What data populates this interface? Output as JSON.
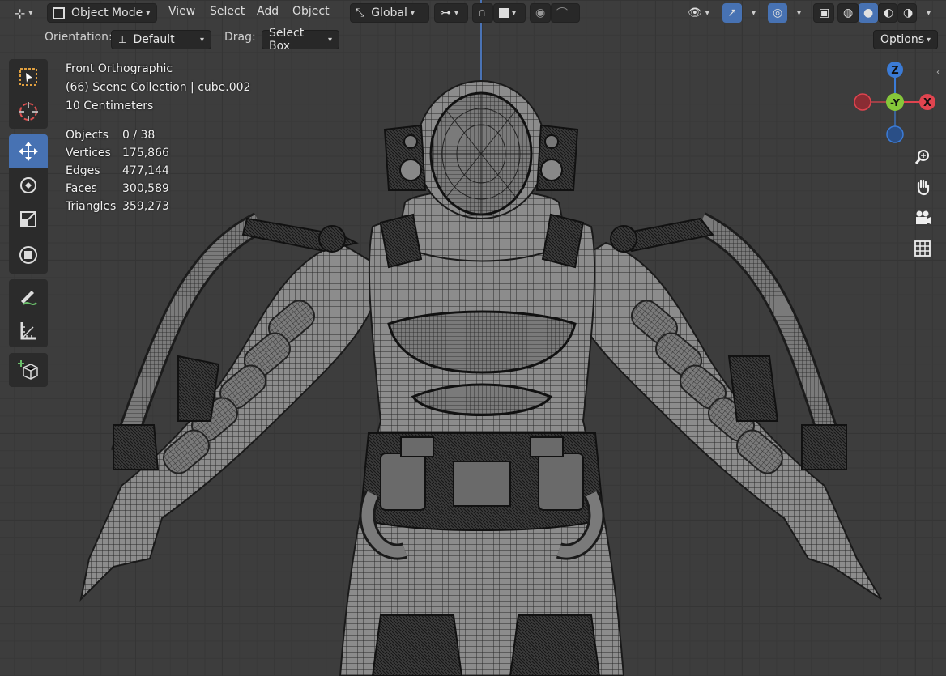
{
  "header": {
    "mode": "Object Mode",
    "menus": [
      "View",
      "Select",
      "Add",
      "Object"
    ],
    "transform_orientation": "Global",
    "options_label": "Options"
  },
  "toolbar_row2": {
    "orientation_label": "Orientation:",
    "orientation_value": "Default",
    "drag_label": "Drag:",
    "drag_value": "Select Box"
  },
  "overlay": {
    "view_name": "Front Orthographic",
    "collection": "(66) Scene Collection | cube.002",
    "scale": "10 Centimeters",
    "stats": [
      {
        "label": "Objects",
        "value": "0 / 38"
      },
      {
        "label": "Vertices",
        "value": "175,866"
      },
      {
        "label": "Edges",
        "value": "477,144"
      },
      {
        "label": "Faces",
        "value": "300,589"
      },
      {
        "label": "Triangles",
        "value": "359,273"
      }
    ]
  },
  "gizmo": {
    "z_label": "Z",
    "y_label": "-Y",
    "x_label": "X",
    "colors": {
      "x": "#e0444f",
      "y": "#86c73a",
      "z": "#3b7bd6"
    }
  },
  "tools": [
    "select-box",
    "cursor",
    "move",
    "rotate",
    "scale",
    "transform",
    "annotate",
    "measure",
    "add-cube"
  ],
  "accent_color": "#4772b3"
}
